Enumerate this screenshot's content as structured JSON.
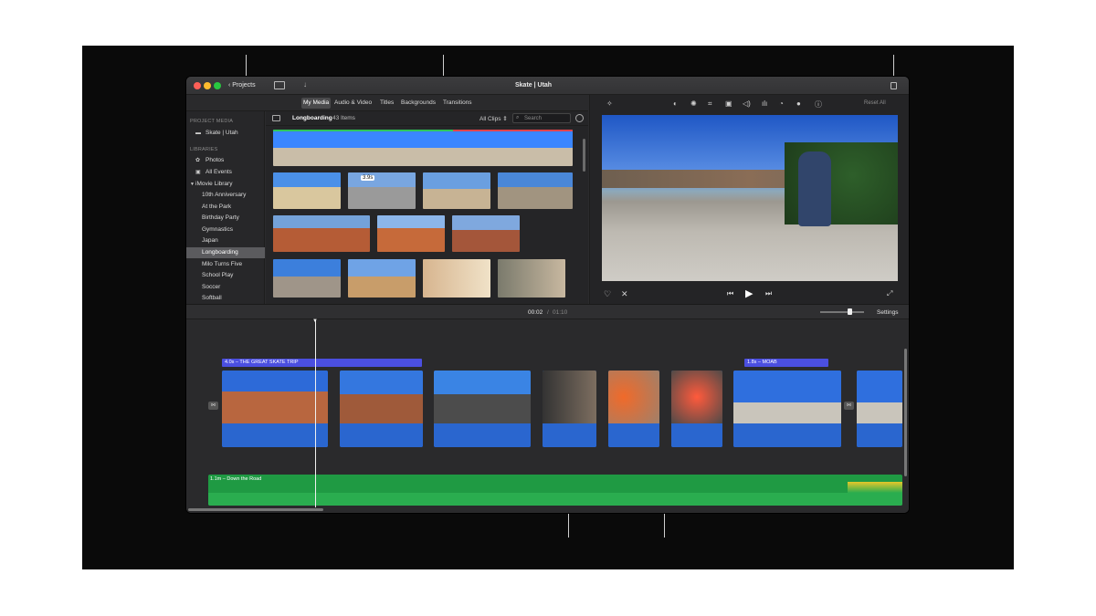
{
  "window": {
    "title": "Skate | Utah",
    "back_label": "Projects"
  },
  "tabs": [
    "My Media",
    "Audio & Video",
    "Titles",
    "Backgrounds",
    "Transitions"
  ],
  "sidebar": {
    "project_media_heading": "PROJECT MEDIA",
    "project_item": "Skate | Utah",
    "libraries_heading": "LIBRARIES",
    "library_items": [
      "Photos",
      "All Events"
    ],
    "imovie_library": "iMovie Library",
    "events": [
      "10th Anniversary",
      "At the Park",
      "Birthday Party",
      "Gymnastics",
      "Japan",
      "Longboarding",
      "Milo Turns Five",
      "School Play",
      "Soccer",
      "Softball"
    ],
    "selected_event": "Longboarding"
  },
  "browser": {
    "event_name": "Longboarding",
    "item_count": "43 Items",
    "filter": "All Clips",
    "search_placeholder": "Search",
    "badge_duration": "3.9s"
  },
  "viewer": {
    "reset_label": "Reset All"
  },
  "timeline": {
    "current_time": "00:02",
    "separator": "/",
    "total_time": "01:10",
    "settings_label": "Settings",
    "title_clip_1": "4.0s – THE GREAT SKATE TRIP",
    "title_clip_2": "1.8s – MOAB",
    "music_clip": "1.1m – Down the Road"
  },
  "colors": {
    "accent": "#4b4fe0",
    "video_audio": "#2a66cf",
    "music": "#1f9a43",
    "close": "#fe5f57",
    "minimize": "#febc2e",
    "zoom": "#28c840"
  }
}
